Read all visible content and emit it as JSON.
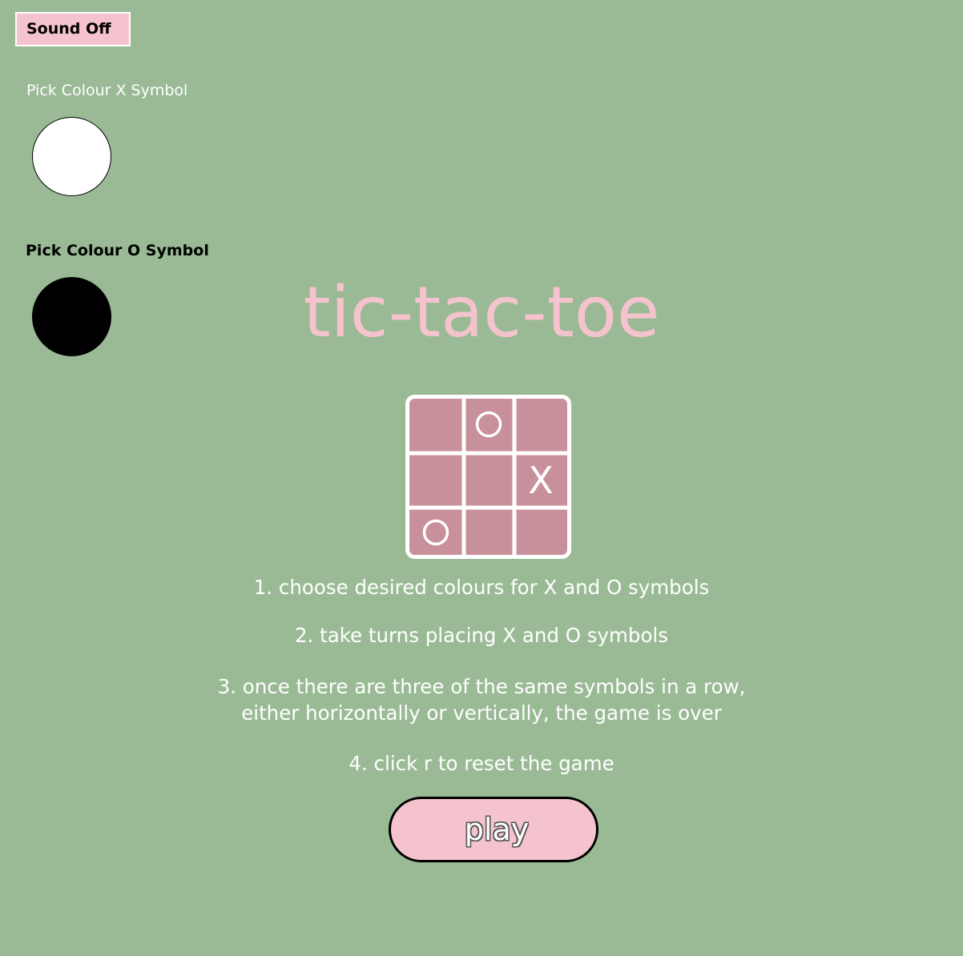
{
  "colors": {
    "background": "#9aba95",
    "accent_pink": "#f5c3cd",
    "board_fill": "#c8909a",
    "x_symbol_colour": "#ffffff",
    "o_symbol_colour": "#000000"
  },
  "sound_button": {
    "label": "Sound Off"
  },
  "colour_picker_x": {
    "label": "Pick Colour X Symbol"
  },
  "colour_picker_o": {
    "label": "Pick Colour O Symbol"
  },
  "title": "tic-tac-toe",
  "board_preview": {
    "cells": [
      "",
      "O",
      "",
      "",
      "",
      "X",
      "O",
      "",
      ""
    ]
  },
  "instructions": {
    "step1": "1. choose desired colours for X and O symbols",
    "step2": "2. take turns placing X and O symbols",
    "step3_line1": "3. once there are three of the same symbols in a row,",
    "step3_line2": "either horizontally or vertically, the game is over",
    "step4": "4. click r to reset the game"
  },
  "play_button": {
    "label": "play"
  }
}
